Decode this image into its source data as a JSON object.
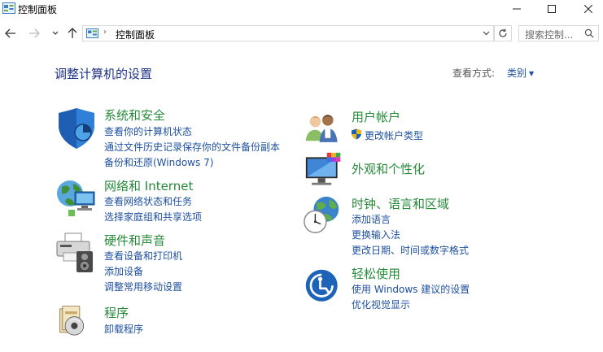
{
  "window": {
    "title": "控制面板"
  },
  "nav": {
    "breadcrumb": "控制面板",
    "search_placeholder": "搜索控制..."
  },
  "page": {
    "heading": "调整计算机的设置",
    "view_by_label": "查看方式:",
    "view_by_value": "类别"
  },
  "categories": {
    "security": {
      "title": "系统和安全",
      "links": [
        "查看你的计算机状态",
        "通过文件历史记录保存你的文件备份副本",
        "备份和还原(Windows 7)"
      ]
    },
    "network": {
      "title": "网络和 Internet",
      "links": [
        "查看网络状态和任务",
        "选择家庭组和共享选项"
      ]
    },
    "hardware": {
      "title": "硬件和声音",
      "links": [
        "查看设备和打印机",
        "添加设备",
        "调整常用移动设置"
      ]
    },
    "programs": {
      "title": "程序",
      "links": [
        "卸载程序"
      ]
    },
    "accounts": {
      "title": "用户帐户",
      "links": [
        "更改帐户类型"
      ]
    },
    "appearance": {
      "title": "外观和个性化",
      "links": []
    },
    "clock": {
      "title": "时钟、语言和区域",
      "links": [
        "添加语言",
        "更换输入法",
        "更改日期、时间或数字格式"
      ]
    },
    "ease": {
      "title": "轻松使用",
      "links": [
        "使用 Windows 建议的设置",
        "优化视觉显示"
      ]
    }
  },
  "colors": {
    "category_title": "#268a3a",
    "link": "#1e50a0",
    "heading": "#1e3287"
  }
}
